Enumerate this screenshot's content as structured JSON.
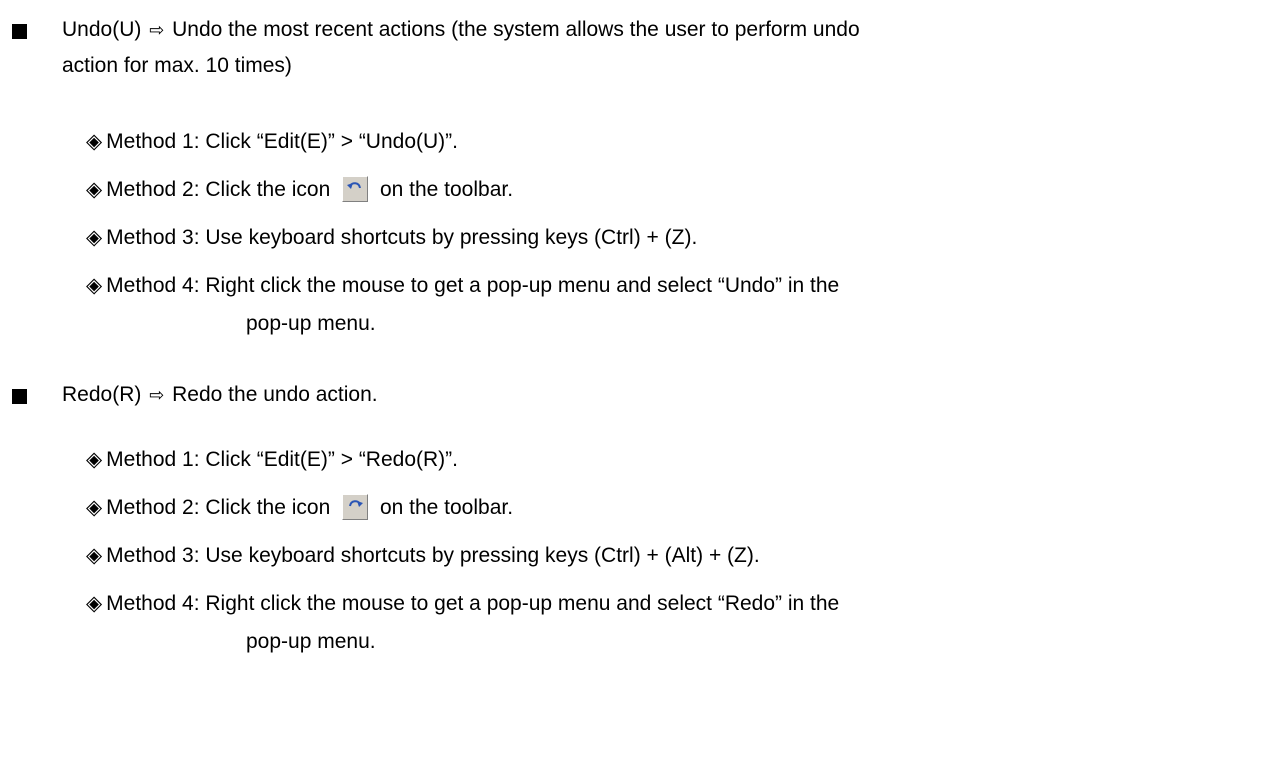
{
  "undo": {
    "heading_prefix": "Undo(U)",
    "arrow_glyph": "⇨",
    "heading_desc_line1": "Undo the most recent actions (the system allows the user to perform undo",
    "heading_desc_line2": "action for max. 10 times)",
    "methods": [
      {
        "glyph": "◈",
        "text": "Method 1: Click “Edit(E)” > “Undo(U)”."
      },
      {
        "glyph": "◈",
        "text_before_icon": "Method 2: Click the icon",
        "icon": "undo-icon",
        "text_after_icon": "on the toolbar."
      },
      {
        "glyph": "◈",
        "text": "Method 3: Use keyboard shortcuts by pressing keys (Ctrl) + (Z)."
      },
      {
        "glyph": "◈",
        "text": "Method 4: Right click the mouse to get a pop-up menu and select “Undo” in the",
        "continuation": "pop-up menu."
      }
    ]
  },
  "redo": {
    "heading_prefix": "Redo(R)",
    "arrow_glyph": "⇨",
    "heading_desc": "Redo the undo action.",
    "methods": [
      {
        "glyph": "◈",
        "text": "Method 1: Click “Edit(E)” > “Redo(R)”."
      },
      {
        "glyph": "◈",
        "text_before_icon": "Method 2: Click the icon",
        "icon": "redo-icon",
        "text_after_icon": "on the toolbar."
      },
      {
        "glyph": "◈",
        "text": "Method 3: Use keyboard shortcuts by pressing keys (Ctrl) + (Alt) + (Z)."
      },
      {
        "glyph": "◈",
        "text": "Method 4: Right click the mouse to get a pop-up menu and select “Redo” in the",
        "continuation": "pop-up menu."
      }
    ]
  },
  "colors": {
    "text": "#000000",
    "icon_face": "#d4d0c8",
    "icon_arrow": "#2a55b5"
  }
}
